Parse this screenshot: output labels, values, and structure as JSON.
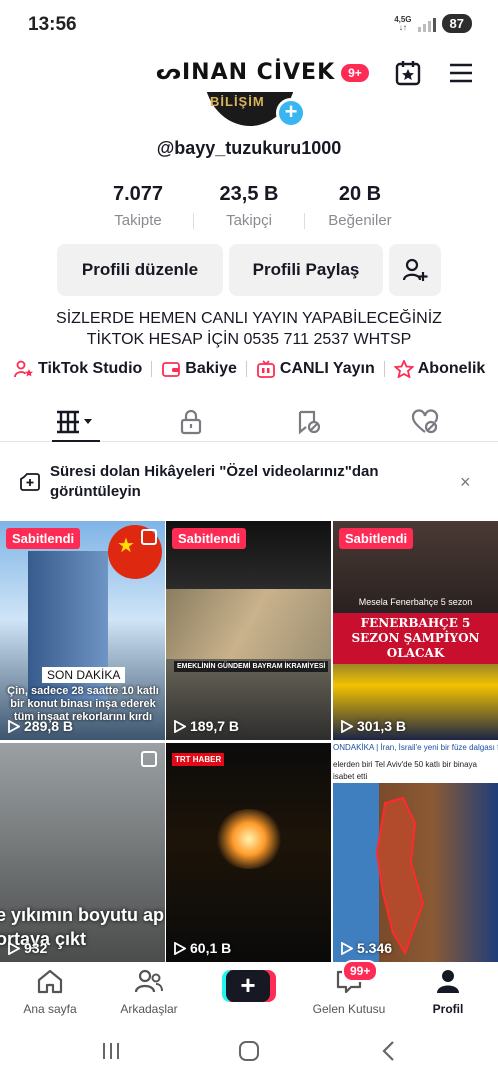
{
  "status": {
    "time": "13:56",
    "network": "4,5G",
    "battery": "87"
  },
  "header": {
    "brand": "ᔕINAN CİVEK",
    "badge": "9+"
  },
  "profile": {
    "avatar_text": "BİLİŞİM",
    "username": "@bayy_tuzukuru1000",
    "stats": [
      {
        "value": "7.077",
        "label": "Takipte"
      },
      {
        "value": "23,5 B",
        "label": "Takipçi"
      },
      {
        "value": "20 B",
        "label": "Beğeniler"
      }
    ],
    "buttons": {
      "edit": "Profili düzenle",
      "share": "Profili Paylaş"
    },
    "bio": [
      "SİZLERDE HEMEN CANLI YAYIN YAPABİLECEĞİNİZ",
      "TİKTOK HESAP İÇİN 0535 711 2537 WHTSP"
    ]
  },
  "tools": [
    "TikTok Studio",
    "Bakiye",
    "CANLI Yayın",
    "Abonelik"
  ],
  "banner": {
    "text": "Süresi dolan Hikâyeleri \"Özel videolarınız\"dan görüntüleyin",
    "close": "×"
  },
  "videos": [
    {
      "pinned": "Sabitlendi",
      "views": "289,8 B",
      "caption_tag": "SON DAKİKA",
      "caption": "Çin, sadece 28 saatte 10 katlı bir konut binası inşa ederek tüm inşaat rekorlarını kırdı"
    },
    {
      "pinned": "Sabitlendi",
      "views": "189,7 B",
      "caption_tag": "EMEKLİNİN GÜNDEMİ BAYRAM İKRAMİYESİ",
      "caption": ""
    },
    {
      "pinned": "Sabitlendi",
      "views": "301,3 B",
      "caption_tag": "Mesela Fenerbahçe 5 sezon",
      "caption": "FENERBAHÇE 5 SEZON ŞAMPİYON OLACAK"
    },
    {
      "pinned": "",
      "views": "932",
      "caption_tag": "",
      "caption": "e yıkımın boyutu ap ortaya çıkt"
    },
    {
      "pinned": "",
      "views": "60,1 B",
      "caption_tag": "TRT HABER",
      "caption": ""
    },
    {
      "pinned": "",
      "views": "5.346",
      "caption_tag": "ONDAKİKA | İran, İsrail'e yeni bir füze dalgası fırlattı",
      "caption": "elerden biri Tel Aviv'de 50 katlı bir binaya isabet etti"
    }
  ],
  "nav": {
    "home": "Ana sayfa",
    "friends": "Arkadaşlar",
    "inbox": "Gelen Kutusu",
    "inbox_badge": "99+",
    "profile": "Profil"
  }
}
